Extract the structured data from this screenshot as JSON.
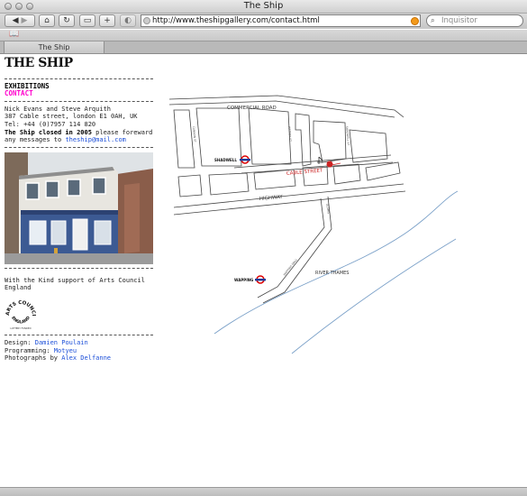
{
  "window": {
    "title": "The Ship"
  },
  "toolbar": {
    "url": "http://www.theshipgallery.com/contact.html",
    "search_placeholder": "Inquisitor",
    "add_label": "+"
  },
  "tabs": [
    {
      "label": "The Ship"
    }
  ],
  "page": {
    "logo": "THE SHIP",
    "nav": {
      "exhibitions": "EXHIBITIONS",
      "contact": "CONTACT"
    },
    "contact": {
      "names": "Nick Evans and Steve Arquith",
      "address": "387 Cable street, london E1 0AH, UK",
      "tel": "Tel: +44 (0)7957 114 820",
      "closed_bold": "The Ship closed in 2005",
      "closed_rest": " please foreward",
      "messages_to": "any messages to",
      "email": "theship@mail.com"
    },
    "support_text": "With the Kind support of Arts Council England",
    "arts_council": {
      "top": "ARTS COUNCIL",
      "bottom": "ENGLAND",
      "small": "LOTTERY FUNDED"
    },
    "credits": {
      "design_label": "Design:",
      "design_name": "Damien Poulain",
      "programming_label": "Programming:",
      "programming_name": "Motyeu",
      "photos_label": "Photographs by",
      "photos_name": "Alex Delfanne"
    },
    "map": {
      "streets": [
        "COMMERCIAL ROAD",
        "CABLE STREET",
        "HIGHWAY",
        "RIVER THAMES",
        "CANNON ST",
        "WATNEY ST",
        "SHADWELL ST",
        "WAPPING WALL",
        "GLAMIS"
      ],
      "stations": [
        "SHADWELL",
        "WAPPING"
      ]
    }
  },
  "colors": {
    "contact_accent": "#ff00cc",
    "link": "#1c4fd8",
    "marker": "#cc2222",
    "river": "#7aa0c8"
  }
}
